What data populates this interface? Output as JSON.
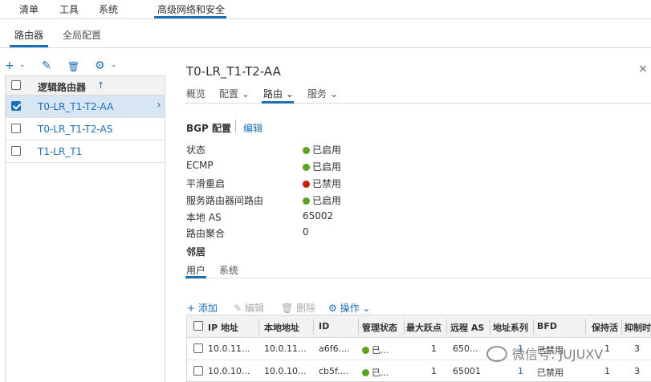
{
  "topnav": {
    "items": [
      "清单",
      "工具",
      "系统",
      "高级网络和安全"
    ]
  },
  "subnav": {
    "items": [
      "路由器",
      "全局配置"
    ]
  },
  "left_toolbar": {
    "add": "+",
    "add_caret": "⌄",
    "edit": "✎",
    "delete": "🗑",
    "settings": "⚙",
    "settings_caret": "⌄"
  },
  "left_panel": {
    "header": "逻辑路由器",
    "sort_icon": "↑",
    "rows": [
      {
        "label": "T0-LR_T1-T2-AA",
        "checked": true,
        "selected": true
      },
      {
        "label": "T0-LR_T1-T2-AS",
        "checked": false,
        "selected": false
      },
      {
        "label": "T1-LR_T1",
        "checked": false,
        "selected": false
      }
    ],
    "row_arrow": "›"
  },
  "detail": {
    "title": "T0-LR_T1-T2-AA",
    "close": "×",
    "tabs": [
      "概览",
      "配置 ⌄",
      "路由 ⌄",
      "服务 ⌄"
    ],
    "bgp_title": "BGP 配置",
    "bgp_edit": "编辑",
    "properties": [
      {
        "key": "状态",
        "value": "已启用",
        "status": "green"
      },
      {
        "key": "ECMP",
        "value": "已启用",
        "status": "green"
      },
      {
        "key": "平滑重启",
        "value": "已禁用",
        "status": "red"
      },
      {
        "key": "服务路由器间路由",
        "value": "已启用",
        "status": "green"
      },
      {
        "key": "本地 AS",
        "value": "65002",
        "status": ""
      },
      {
        "key": "路由聚合",
        "value": "0",
        "status": ""
      }
    ],
    "neighbors_label": "邻居",
    "neighbor_tabs": [
      "用户",
      "系统"
    ]
  },
  "grid_toolbar": {
    "add": "+ 添加",
    "edit": "✎ 编辑",
    "delete": "🗑 删除",
    "actions": "⚙ 操作 ⌄"
  },
  "grid": {
    "headers": [
      "IP 地址",
      "本地地址",
      "ID",
      "管理状态",
      "最大跃点",
      "远程 AS",
      "地址系列",
      "BFD",
      "保持活",
      "抑制时"
    ],
    "rows": [
      [
        "10.0.11...",
        "10.0.11...",
        "a6f6....",
        "已...",
        "1",
        "650...",
        "1",
        "已禁用",
        "1",
        "3"
      ],
      [
        "10.0.10...",
        "10.0.10...",
        "cb5f....",
        "已...",
        "1",
        "65001",
        "1",
        "已禁用",
        "1",
        "3"
      ]
    ]
  },
  "watermark": "微信号: JUJUXV",
  "colors": {
    "accent": "#1b6fb5",
    "enabled": "#5aa220",
    "disabled": "#c92100",
    "selected_row": "#d7e6f2"
  }
}
